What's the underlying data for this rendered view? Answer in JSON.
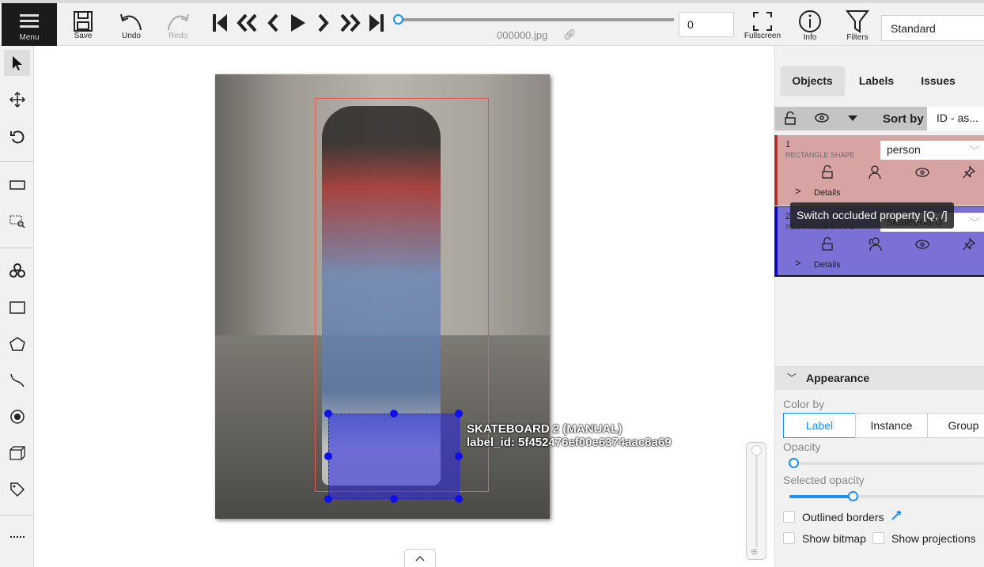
{
  "topbar": {
    "menu": "Menu",
    "save": "Save",
    "undo": "Undo",
    "redo": "Redo",
    "filename": "000000.jpg",
    "frame_number": "0",
    "fullscreen": "Fullscreen",
    "info": "Info",
    "filters": "Filters",
    "workspace": "Standard",
    "frame_progress": 0
  },
  "canvas": {
    "object_label_title": "SKATEBOARD 2 (MANUAL)",
    "object_label_id": "label_id: 5f452476ef00e6374aac8a69"
  },
  "panel": {
    "tabs": [
      "Objects",
      "Labels",
      "Issues"
    ],
    "sort_by_label": "Sort by",
    "sort_by_value": "ID - as...",
    "objects": [
      {
        "id": "1",
        "type": "RECTANGLE SHAPE",
        "label": "person",
        "details": "Details",
        "color": "#d8a3a3"
      },
      {
        "id": "2",
        "type": "RECTANGLE SHAPE",
        "label": "skateboard",
        "details": "Details",
        "color": "#7a70d6"
      }
    ],
    "tooltip": "Switch occluded property [Q, /]",
    "appearance": {
      "title": "Appearance",
      "color_by": "Color by",
      "options": [
        "Label",
        "Instance",
        "Group"
      ],
      "selected": "Label",
      "opacity": "Opacity",
      "opacity_value": 0,
      "selected_opacity": "Selected opacity",
      "selected_opacity_value": 0.4,
      "outlined_borders": "Outlined borders",
      "show_bitmap": "Show bitmap",
      "show_projections": "Show projections"
    }
  }
}
